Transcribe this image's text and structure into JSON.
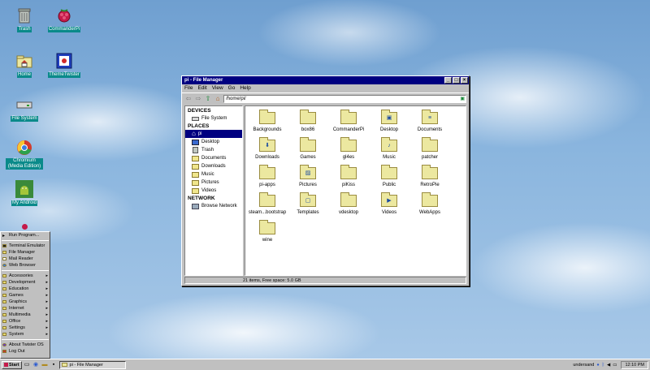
{
  "desktop": {
    "icons": [
      {
        "label": "Trash",
        "icon": "trash-icon"
      },
      {
        "label": "CommanderPi",
        "icon": "raspberry-icon"
      },
      {
        "label": "Home",
        "icon": "home-folder-icon"
      },
      {
        "label": "ThemeTwister",
        "icon": "theme-twister-icon"
      },
      {
        "label": "File System",
        "icon": "drive-icon"
      },
      {
        "label": "Chromium (Media Edition)",
        "icon": "chromium-icon"
      },
      {
        "label": "My Android",
        "icon": "android-icon"
      }
    ]
  },
  "window": {
    "title": "pi - File Manager",
    "menu": [
      "File",
      "Edit",
      "View",
      "Go",
      "Help"
    ],
    "path": "/home/pi/",
    "sidebar": {
      "devices_header": "DEVICES",
      "devices": [
        "File System"
      ],
      "places_header": "PLACES",
      "places": [
        "pi",
        "Desktop",
        "Trash",
        "Documents",
        "Downloads",
        "Music",
        "Pictures",
        "Videos"
      ],
      "network_header": "NETWORK",
      "network": [
        "Browse Network"
      ]
    },
    "files": [
      {
        "name": "Backgrounds",
        "emblem": ""
      },
      {
        "name": "box86",
        "emblem": ""
      },
      {
        "name": "CommanderPi",
        "emblem": ""
      },
      {
        "name": "Desktop",
        "emblem": "desktop"
      },
      {
        "name": "Documents",
        "emblem": "doc"
      },
      {
        "name": "Downloads",
        "emblem": "download"
      },
      {
        "name": "Games",
        "emblem": ""
      },
      {
        "name": "gl4es",
        "emblem": ""
      },
      {
        "name": "Music",
        "emblem": "music"
      },
      {
        "name": "patcher",
        "emblem": ""
      },
      {
        "name": "pi-apps",
        "emblem": ""
      },
      {
        "name": "Pictures",
        "emblem": "picture"
      },
      {
        "name": "piKiss",
        "emblem": ""
      },
      {
        "name": "Public",
        "emblem": ""
      },
      {
        "name": "RetroPie",
        "emblem": ""
      },
      {
        "name": "steam...bootstrap",
        "emblem": ""
      },
      {
        "name": "Templates",
        "emblem": "template"
      },
      {
        "name": "vdesktop",
        "emblem": ""
      },
      {
        "name": "Videos",
        "emblem": "video"
      },
      {
        "name": "WebApps",
        "emblem": ""
      },
      {
        "name": "wine",
        "emblem": ""
      }
    ],
    "status": "21 items, Free space: 5.0 GB"
  },
  "start_menu": {
    "top_items": [
      "Run Program..."
    ],
    "apps": [
      "Terminal Emulator",
      "File Manager",
      "Mail Reader",
      "Web Browser"
    ],
    "categories": [
      "Accessories",
      "Development",
      "Education",
      "Games",
      "Graphics",
      "Internet",
      "Multimedia",
      "Office",
      "Settings",
      "System"
    ],
    "bottom_items": [
      "About Twister OS",
      "Log Out"
    ]
  },
  "taskbar": {
    "start_label": "Start",
    "task": "pi - File Manager",
    "tray_user": "undersand",
    "clock": "12:10 PM"
  }
}
